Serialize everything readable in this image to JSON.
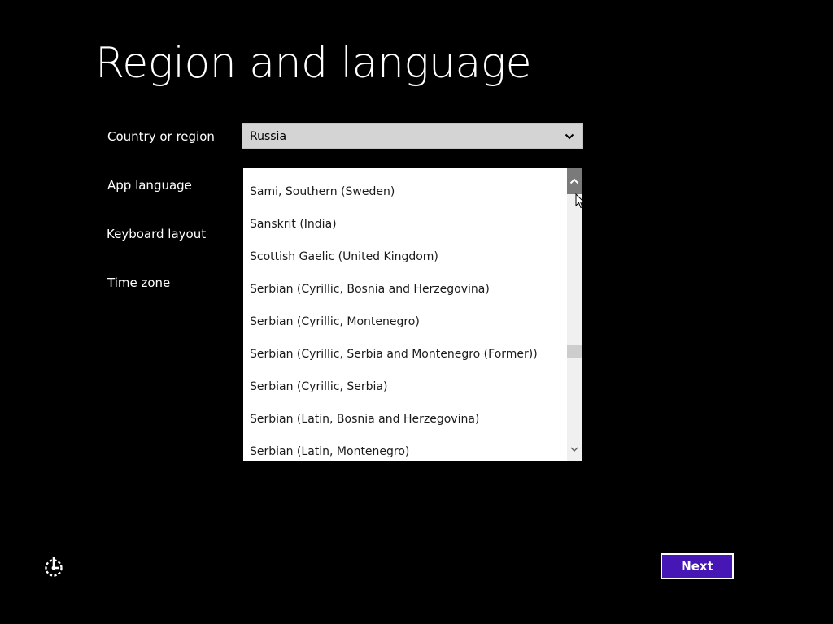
{
  "title": "Region and language",
  "labels": {
    "country": "Country or region",
    "app_language": "App language",
    "keyboard": "Keyboard layout",
    "timezone": "Time zone"
  },
  "country_select": {
    "value": "Russia",
    "icon": "chevron-down-icon"
  },
  "app_language_list": {
    "items": [
      "Sami, Southern (Sweden)",
      "Sanskrit (India)",
      "Scottish Gaelic (United Kingdom)",
      "Serbian (Cyrillic, Bosnia and Herzegovina)",
      "Serbian (Cyrillic, Montenegro)",
      "Serbian (Cyrillic, Serbia and Montenegro (Former))",
      "Serbian (Cyrillic, Serbia)",
      "Serbian (Latin, Bosnia and Herzegovina)",
      "Serbian (Latin, Montenegro)"
    ],
    "scroll_position": 0.66
  },
  "footer": {
    "ease_icon": "ease-of-access-icon",
    "next_label": "Next"
  },
  "colors": {
    "background": "#000000",
    "accent": "#4617b4",
    "select_bg": "#d4d4d4",
    "list_bg": "#ffffff"
  }
}
